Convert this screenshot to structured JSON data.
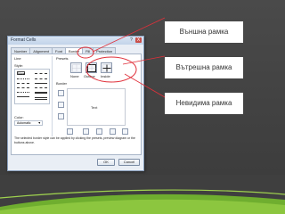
{
  "dialog": {
    "title": "Format Cells",
    "help_btn": "?",
    "close_btn": "X",
    "tabs": [
      {
        "label": "Number"
      },
      {
        "label": "Alignment"
      },
      {
        "label": "Font"
      },
      {
        "label": "Border"
      },
      {
        "label": "Fill"
      },
      {
        "label": "Protection"
      }
    ],
    "line_label": "Line",
    "style_label": "Style:",
    "none_label": "None",
    "color_label": "Color:",
    "color_value": "Automatic",
    "presets_label": "Presets",
    "preset_buttons": [
      {
        "label": "None"
      },
      {
        "label": "Outline"
      },
      {
        "label": "Inside"
      }
    ],
    "border_label": "Border",
    "preview_text": "Text",
    "description": "The selected border style can be applied by clicking the presets, preview diagram or the buttons above.",
    "ok_label": "OK",
    "cancel_label": "Cancel"
  },
  "annotations": [
    {
      "label": "Външна рамка"
    },
    {
      "label": "Вътрешна рамка"
    },
    {
      "label": "Невидима рамка"
    }
  ],
  "colors": {
    "background": "#3f3f3f",
    "annotation_line": "#e0303a",
    "accent_green": "#8cc63f"
  }
}
